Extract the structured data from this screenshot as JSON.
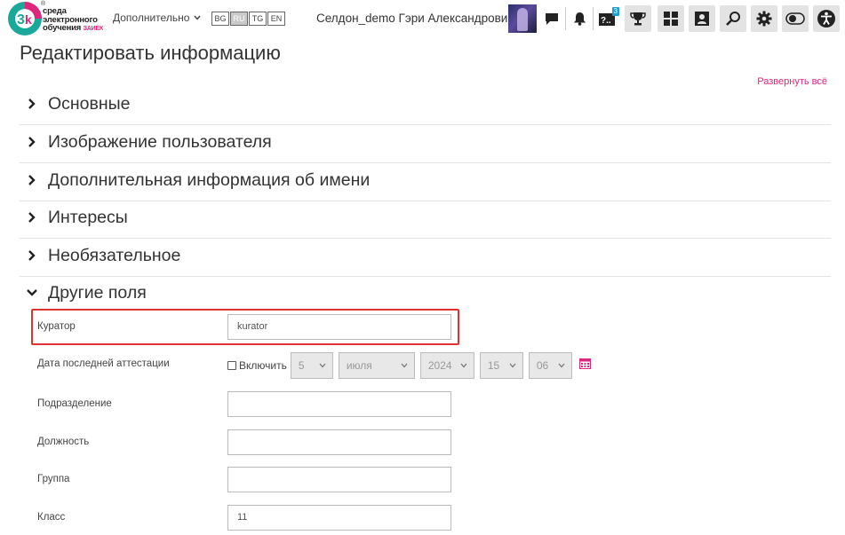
{
  "navbar": {
    "logo_text_line1": "среда",
    "logo_text_line2": "электронного",
    "logo_text_line3": "обучения",
    "logo_text_kn": "ЗАИЕК",
    "logo_reg": "®",
    "more_label": "Дополнительно",
    "languages": [
      "BG",
      "RU",
      "TG",
      "EN"
    ],
    "active_language": "RU",
    "username": "Селдон_demo Гэри Александрович",
    "questions_badge": "3",
    "questions_label": "?.."
  },
  "page": {
    "title": "Редактировать информацию",
    "expand_all": "Развернуть всё"
  },
  "sections": [
    {
      "title": "Основные",
      "expanded": false
    },
    {
      "title": "Изображение пользователя",
      "expanded": false
    },
    {
      "title": "Дополнительная информация об имени",
      "expanded": false
    },
    {
      "title": "Интересы",
      "expanded": false
    },
    {
      "title": "Необязательное",
      "expanded": false
    },
    {
      "title": "Другие поля",
      "expanded": true
    }
  ],
  "fields": {
    "curator": {
      "label": "Куратор",
      "value": "kurator"
    },
    "attestation_date": {
      "label": "Дата последней аттестации",
      "enable_label": "Включить",
      "day": "5",
      "month": "июля",
      "year": "2024",
      "hour": "15",
      "minute": "06"
    },
    "department": {
      "label": "Подразделение",
      "value": ""
    },
    "position": {
      "label": "Должность",
      "value": ""
    },
    "group": {
      "label": "Группа",
      "value": ""
    },
    "class": {
      "label": "Класс",
      "value": "11"
    }
  },
  "colors": {
    "accent": "#e0257c",
    "highlight": "#e03030",
    "logo_teal": "#1aa89a",
    "logo_pink": "#e0257c",
    "badge": "#1a9fd8"
  }
}
